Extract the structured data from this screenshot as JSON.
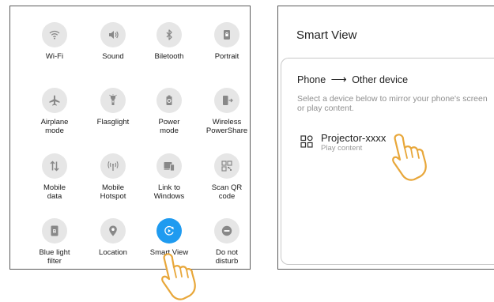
{
  "quick_settings": {
    "tiles": [
      {
        "label": "Wi-Fi",
        "icon": "wifi-icon"
      },
      {
        "label": "Sound",
        "icon": "speaker-icon"
      },
      {
        "label": "Biletooth",
        "icon": "bluetooth-icon"
      },
      {
        "label": "Portrait",
        "icon": "portrait-lock-icon"
      },
      {
        "label": "Airplane\nmode",
        "icon": "airplane-icon"
      },
      {
        "label": "Flasglight",
        "icon": "flashlight-icon"
      },
      {
        "label": "Power\nmode",
        "icon": "battery-icon"
      },
      {
        "label": "Wireless\nPowerShare",
        "icon": "wireless-powershare-icon"
      },
      {
        "label": "Mobile\ndata",
        "icon": "mobile-data-icon"
      },
      {
        "label": "Mobile\nHotspot",
        "icon": "hotspot-icon"
      },
      {
        "label": "Link to\nWindows",
        "icon": "link-to-windows-icon"
      },
      {
        "label": "Scan QR\ncode",
        "icon": "qr-code-icon"
      },
      {
        "label": "Blue light\nfilter",
        "icon": "blue-light-icon"
      },
      {
        "label": "Location",
        "icon": "location-pin-icon"
      },
      {
        "label": "Smart View",
        "icon": "smart-view-icon",
        "active": true
      },
      {
        "label": "Do not\ndisturb",
        "icon": "do-not-disturb-icon"
      }
    ],
    "active_color": "#1f9bf0",
    "tile_color": "#e6e6e6"
  },
  "smart_view": {
    "title": "Smart View",
    "heading_from": "Phone",
    "heading_arrow": "⟶",
    "heading_to": "Other device",
    "description": "Select a device below to mirror your phone's screen or play content.",
    "device": {
      "name": "Projector-xxxx",
      "subtitle": "Play content",
      "icon": "device-grid-icon"
    }
  }
}
